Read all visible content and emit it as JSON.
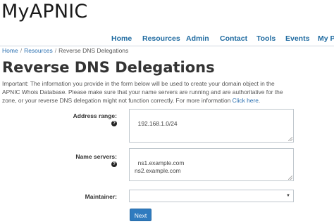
{
  "logo": "MyAPNIC",
  "nav": {
    "items": [
      "Home",
      "Resources",
      "Admin",
      "Contact",
      "Tools",
      "Events",
      "My P"
    ]
  },
  "breadcrumb": {
    "home": "Home",
    "separator": "/",
    "resources": "Resources",
    "current": "Reverse DNS Delegations"
  },
  "page": {
    "title": "Reverse DNS Delegations",
    "intro": "Important: The information you provide in the form below will be used to create your domain object in the APNIC Whois Database. Please make sure that your name servers are running and are authoritative for the zone, or your reverse DNS delegation might not function correctly. For more information ",
    "intro_link": "Click here",
    "intro_end": "."
  },
  "form": {
    "address_range": {
      "label": "Address range:",
      "value": "192.168.1.0/24"
    },
    "name_servers": {
      "label": "Name servers:",
      "value": "ns1.example.com\nns2.example.com"
    },
    "maintainer": {
      "label": "Maintainer:",
      "value": ""
    },
    "next_label": "Next"
  },
  "colors": {
    "nav_link": "#1e6aa0",
    "link": "#2a6fb0",
    "button": "#2f7bbf"
  }
}
